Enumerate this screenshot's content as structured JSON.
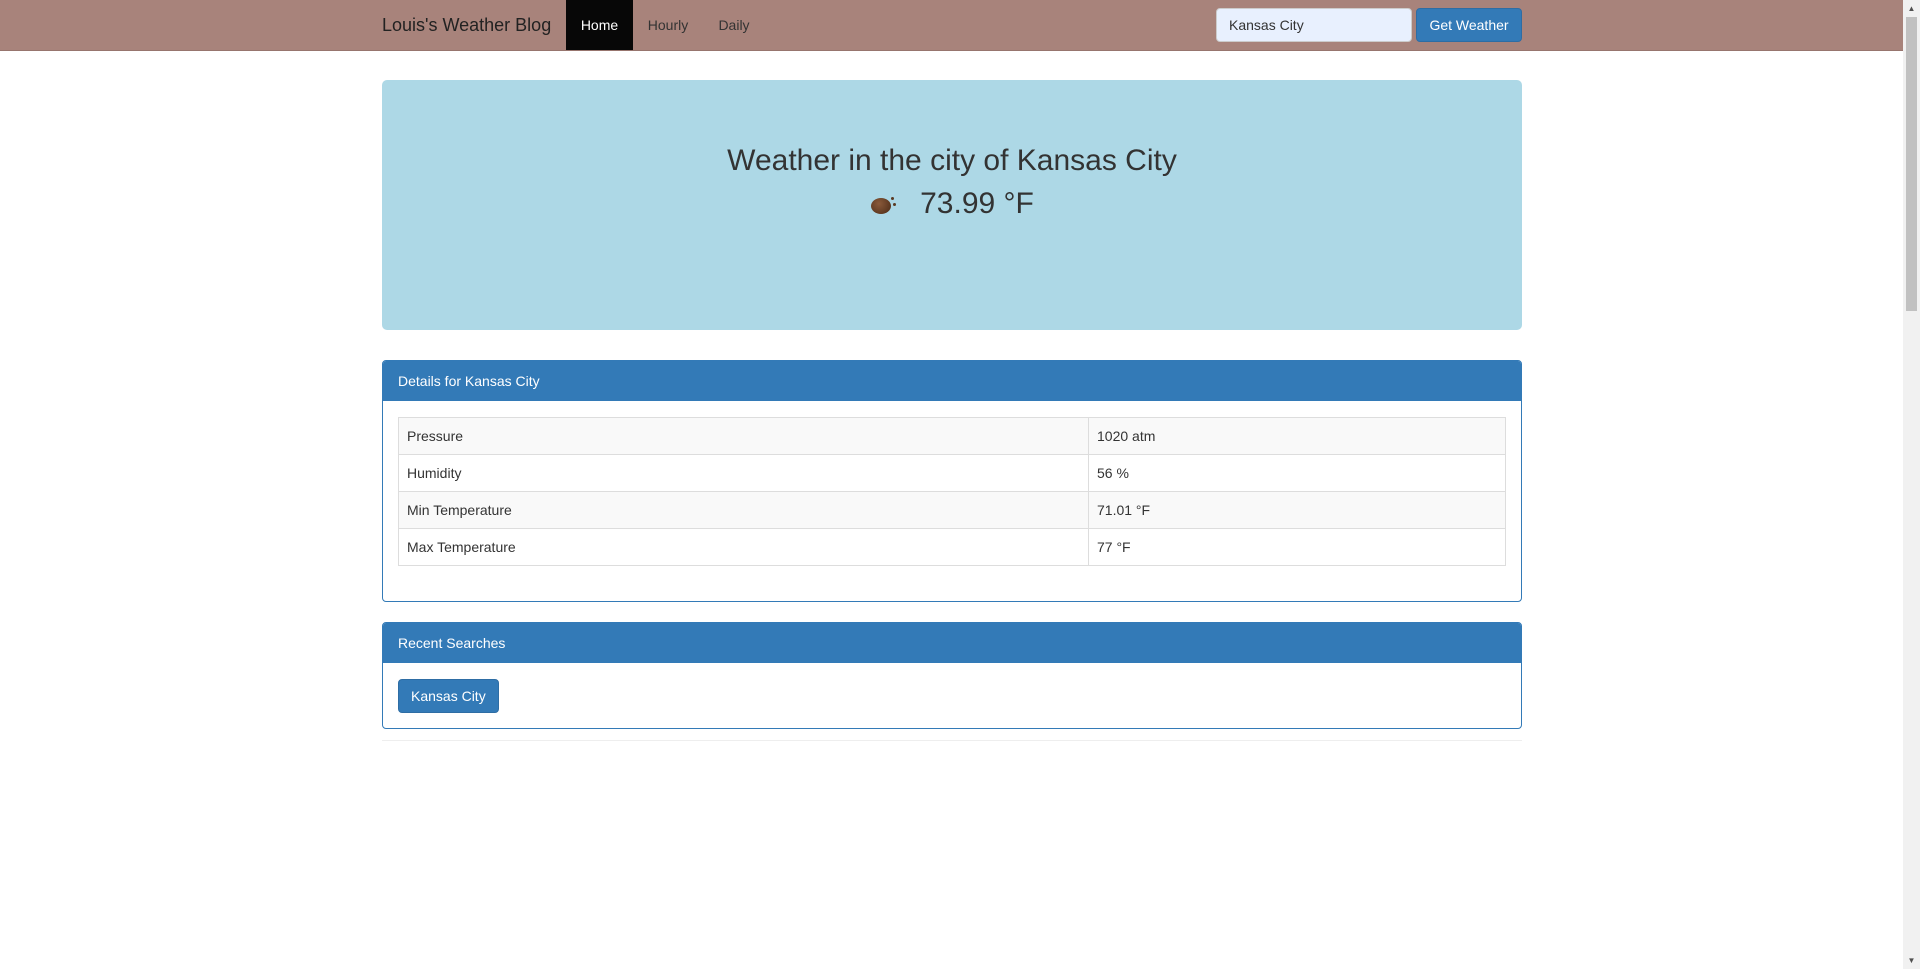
{
  "navbar": {
    "brand": "Louis's Weather Blog",
    "items": [
      {
        "label": "Home",
        "active": true
      },
      {
        "label": "Hourly",
        "active": false
      },
      {
        "label": "Daily",
        "active": false
      }
    ],
    "search_value": "Kansas City",
    "search_button": "Get Weather"
  },
  "hero": {
    "title": "Weather in the city of Kansas City",
    "temperature": "73.99 °F",
    "icon": "weather-condition-icon"
  },
  "details": {
    "heading": "Details for Kansas City",
    "rows": [
      {
        "label": "Pressure",
        "value": "1020 atm"
      },
      {
        "label": "Humidity",
        "value": "56 %"
      },
      {
        "label": "Min Temperature",
        "value": "71.01 °F"
      },
      {
        "label": "Max Temperature",
        "value": "77 °F"
      }
    ]
  },
  "recent": {
    "heading": "Recent Searches",
    "items": [
      "Kansas City"
    ]
  },
  "colors": {
    "navbar": "#a8837b",
    "hero": "#add8e6",
    "primary": "#337ab7",
    "active_nav": "#070707"
  }
}
